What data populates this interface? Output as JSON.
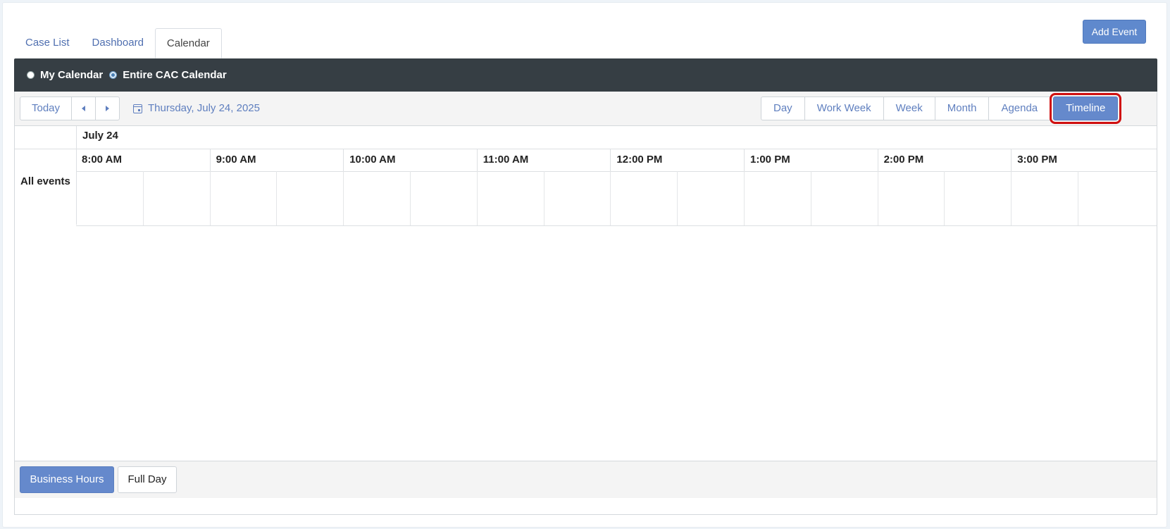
{
  "header": {
    "add_event_label": "Add Event"
  },
  "tabs": [
    {
      "label": "Case List"
    },
    {
      "label": "Dashboard"
    },
    {
      "label": "Calendar",
      "active": true
    }
  ],
  "scope": {
    "options": [
      {
        "label": "My Calendar",
        "checked": false
      },
      {
        "label": "Entire CAC Calendar",
        "checked": true
      }
    ]
  },
  "toolbar": {
    "today_label": "Today",
    "prev_icon": "triangle-left-icon",
    "next_icon": "triangle-right-icon",
    "calendar_icon": "calendar-icon",
    "current_date": "Thursday, July 24, 2025",
    "views": [
      {
        "label": "Day"
      },
      {
        "label": "Work Week"
      },
      {
        "label": "Week"
      },
      {
        "label": "Month"
      },
      {
        "label": "Agenda"
      },
      {
        "label": "Timeline",
        "active": true
      }
    ]
  },
  "timeline": {
    "date_header": "July 24",
    "row_label": "All events",
    "times": [
      "8:00 AM",
      "9:00 AM",
      "10:00 AM",
      "11:00 AM",
      "12:00 PM",
      "1:00 PM",
      "2:00 PM",
      "3:00 PM"
    ]
  },
  "footer": {
    "business_hours_label": "Business Hours",
    "full_day_label": "Full Day"
  },
  "colors": {
    "accent": "#6589cc",
    "scope_bar": "#363e44",
    "highlight": "#d01010",
    "link": "#5f7fbf"
  }
}
